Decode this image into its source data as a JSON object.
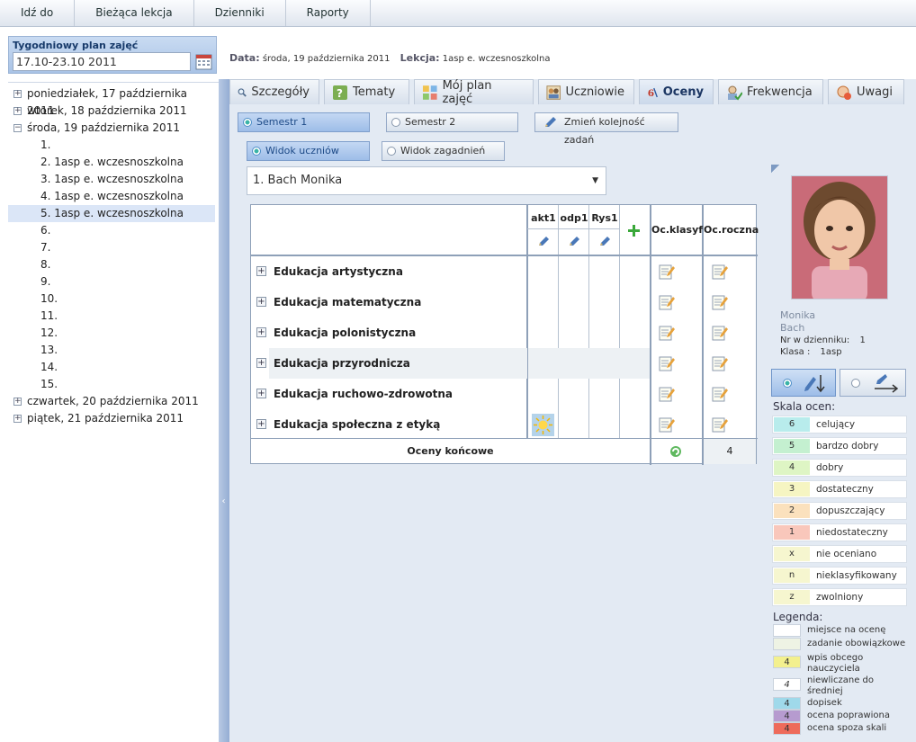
{
  "topmenu": [
    "Idź do",
    "Bieżąca lekcja",
    "Dzienniki",
    "Raporty"
  ],
  "week": {
    "label": "Tygodniowy plan zajęć",
    "value": "17.10-23.10 2011"
  },
  "datebar": {
    "date_label": "Data:",
    "date_value": "środa, 19 października 2011",
    "lesson_label": "Lekcja:",
    "lesson_value": "1asp e. wczesnoszkolna"
  },
  "tree": [
    {
      "label": "poniedziałek, 17 października 2011",
      "toggle": "+"
    },
    {
      "label": "wtorek, 18 października 2011",
      "toggle": "+"
    },
    {
      "label": "środa, 19 października 2011",
      "toggle": "−"
    },
    {
      "label": "1."
    },
    {
      "label": "2. 1asp e. wczesnoszkolna"
    },
    {
      "label": "3. 1asp e. wczesnoszkolna"
    },
    {
      "label": "4. 1asp e. wczesnoszkolna"
    },
    {
      "label": "5. 1asp e. wczesnoszkolna",
      "selected": true
    },
    {
      "label": "6."
    },
    {
      "label": "7."
    },
    {
      "label": "8."
    },
    {
      "label": "9."
    },
    {
      "label": "10."
    },
    {
      "label": "11."
    },
    {
      "label": "12."
    },
    {
      "label": "13."
    },
    {
      "label": "14."
    },
    {
      "label": "15."
    },
    {
      "label": "czwartek, 20 października 2011",
      "toggle": "+"
    },
    {
      "label": "piątek, 21 października 2011",
      "toggle": "+"
    }
  ],
  "tabs": [
    {
      "label": "Szczegóły",
      "icon": "magnifier-icon"
    },
    {
      "label": "Tematy",
      "icon": "question-book-icon"
    },
    {
      "label": "Mój plan zajęć",
      "icon": "plan-grid-icon"
    },
    {
      "label": "Uczniowie",
      "icon": "students-icon"
    },
    {
      "label": "Oceny",
      "icon": "grades-icon",
      "active": true
    },
    {
      "label": "Frekwencja",
      "icon": "attendance-icon"
    },
    {
      "label": "Uwagi",
      "icon": "remarks-icon"
    }
  ],
  "buttons": {
    "semestr1": "Semestr 1",
    "semestr2": "Semestr 2",
    "reorder": "Zmień kolejność zadań",
    "view_students": "Widok uczniów",
    "view_topics": "Widok zagadnień"
  },
  "student_select": "1. Bach Monika",
  "grades": {
    "columns": [
      "akt1",
      "odp1",
      "Rys1"
    ],
    "class_col": "Oc.klasyf",
    "year_col": "Oc.roczna",
    "subjects": [
      "Edukacja artystyczna",
      "Edukacja matematyczna",
      "Edukacja polonistyczna",
      "Edukacja przyrodnicza",
      "Edukacja ruchowo-zdrowotna",
      "Edukacja społeczna z etyką"
    ],
    "final_label": "Oceny końcowe",
    "final_year_value": "4"
  },
  "student": {
    "first": "Monika",
    "last": "Bach",
    "nr_label": "Nr w dzienniku:",
    "nr": "1",
    "class_label": "Klasa :",
    "class": "1asp"
  },
  "scale": {
    "title": "Skala ocen:",
    "items": [
      {
        "code": "6",
        "label": "celujący",
        "color": "#b8ecec"
      },
      {
        "code": "5",
        "label": "bardzo dobry",
        "color": "#c4f0d0"
      },
      {
        "code": "4",
        "label": "dobry",
        "color": "#def5c4"
      },
      {
        "code": "3",
        "label": "dostateczny",
        "color": "#f6f5c2"
      },
      {
        "code": "2",
        "label": "dopuszczający",
        "color": "#fbe1bd"
      },
      {
        "code": "1",
        "label": "niedostateczny",
        "color": "#f9c7bb"
      },
      {
        "code": "x",
        "label": "nie oceniano",
        "color": "#f6f6cf"
      },
      {
        "code": "n",
        "label": "nieklasyfikowany",
        "color": "#f6f6cf"
      },
      {
        "code": "z",
        "label": "zwolniony",
        "color": "#f6f6cf"
      }
    ]
  },
  "legend": {
    "title": "Legenda:",
    "items": [
      {
        "code": "",
        "label": "miejsce na ocenę",
        "color": "#ffffff"
      },
      {
        "code": "",
        "label": "zadanie obowiązkowe",
        "color": "#eef3e4"
      },
      {
        "code": "4",
        "label": "wpis obcego nauczyciela",
        "color": "#f3f08e"
      },
      {
        "code": "4",
        "label": "niewliczane do średniej",
        "color": "#ffffff"
      },
      {
        "code": "4",
        "label": "dopisek",
        "color": "#9fd9ea"
      },
      {
        "code": "4",
        "label": "ocena poprawiona",
        "color": "#b69bcf"
      },
      {
        "code": "4",
        "label": "ocena spoza skali",
        "color": "#ee6b5b"
      }
    ]
  }
}
